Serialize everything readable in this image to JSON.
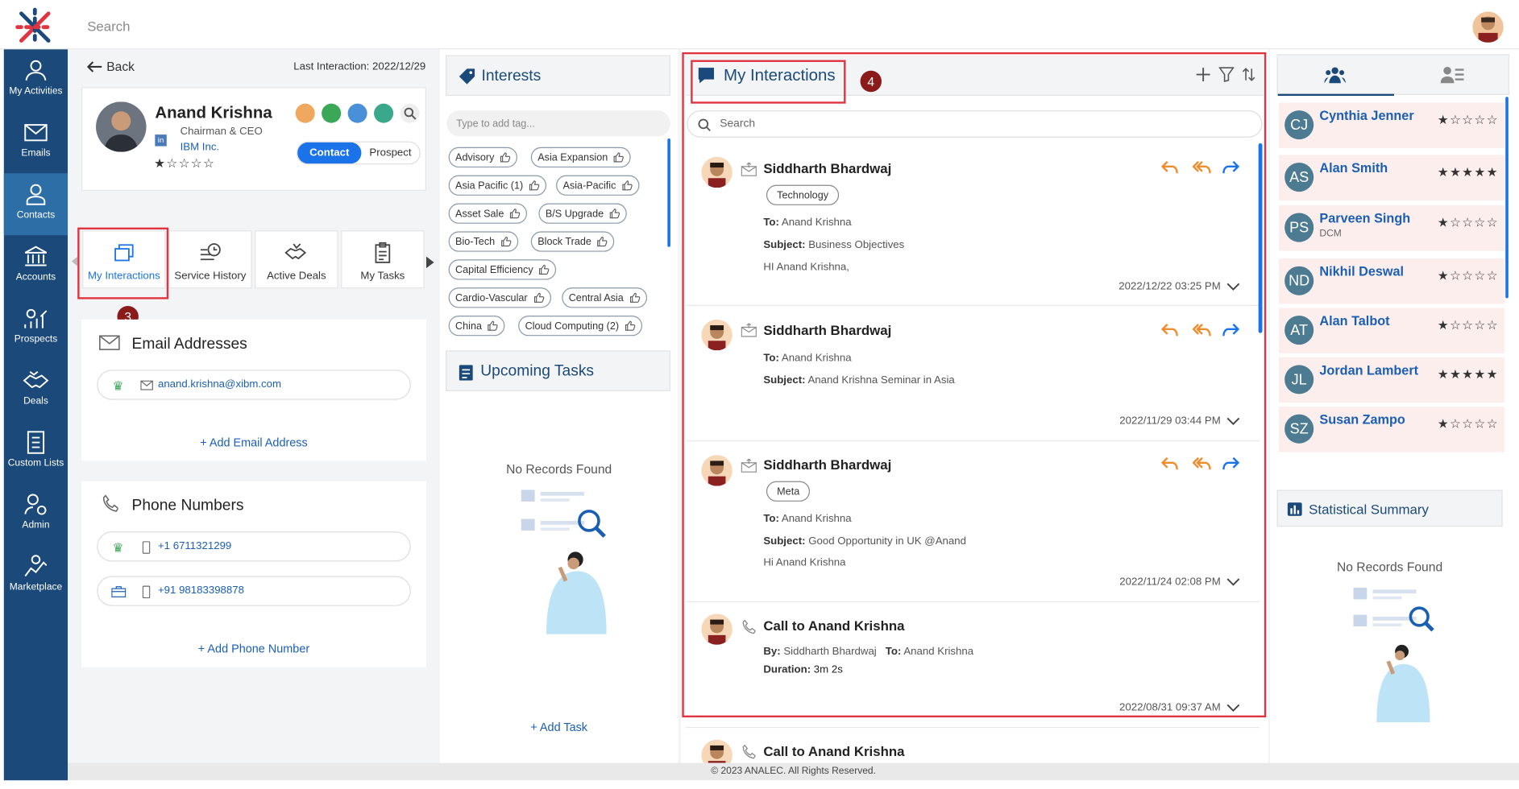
{
  "topbar": {
    "search_placeholder": "Search"
  },
  "sidebar": {
    "items": [
      {
        "label": "My Activities",
        "icon": "user-icon"
      },
      {
        "label": "Emails",
        "icon": "mail-icon"
      },
      {
        "label": "Contacts",
        "icon": "contact-icon"
      },
      {
        "label": "Accounts",
        "icon": "bank-icon"
      },
      {
        "label": "Prospects",
        "icon": "prospects-icon"
      },
      {
        "label": "Deals",
        "icon": "handshake-icon"
      },
      {
        "label": "Custom Lists",
        "icon": "list-icon"
      },
      {
        "label": "Admin",
        "icon": "admin-icon"
      },
      {
        "label": "Marketplace",
        "icon": "marketplace-icon"
      }
    ]
  },
  "contact": {
    "back": "Back",
    "last_interaction": "Last Interaction: 2022/12/29",
    "name": "Anand Krishna",
    "title": "Chairman & CEO",
    "company": "IBM Inc.",
    "toggle": [
      "Contact",
      "Prospect"
    ]
  },
  "tabs": [
    "My Interactions",
    "Service History",
    "Active Deals",
    "My Tasks"
  ],
  "badges": {
    "b3": "3",
    "b4": "4"
  },
  "emails": {
    "heading": "Email Addresses",
    "items": [
      "anand.krishna@xibm.com"
    ],
    "add": "+ Add Email Address"
  },
  "phones": {
    "heading": "Phone Numbers",
    "items": [
      "+1 6711321299",
      "+91 98183398878"
    ],
    "add": "+ Add Phone Number"
  },
  "interests": {
    "heading": "Interests",
    "placeholder": "Type to add tag...",
    "tags": [
      "Advisory",
      "Asia Expansion",
      "Asia Pacific (1)",
      "Asia-Pacific",
      "Asset Sale",
      "B/S Upgrade",
      "Bio-Tech",
      "Block Trade",
      "Capital Efficiency",
      "Cardio-Vascular",
      "Central Asia",
      "China",
      "Cloud Computing (2)"
    ]
  },
  "tasks": {
    "heading": "Upcoming Tasks",
    "empty": "No Records Found",
    "add": "+ Add Task"
  },
  "interactions": {
    "heading": "My Interactions",
    "search_placeholder": "Search",
    "items": [
      {
        "name": "Siddharth Bhardwaj",
        "tag": "Technology",
        "to": "Anand Krishna",
        "subject": "Business Objectives",
        "body": "HI Anand Krishna,",
        "date": "2022/12/22 03:25 PM"
      },
      {
        "name": "Siddharth Bhardwaj",
        "to": "Anand Krishna",
        "subject": "Anand Krishna Seminar in Asia",
        "date": "2022/11/29 03:44 PM"
      },
      {
        "name": "Siddharth Bhardwaj",
        "tag": "Meta",
        "to": "Anand Krishna",
        "subject": "Good Opportunity in UK @Anand",
        "body": "Hi Anand Krishna",
        "date": "2022/11/24 02:08 PM"
      },
      {
        "name": "Call to Anand Krishna",
        "by": "Siddharth Bhardwaj",
        "to": "Anand Krishna",
        "duration": "3m 2s",
        "date": "2022/08/31 09:37 AM"
      },
      {
        "name": "Call to Anand Krishna"
      }
    ],
    "labels": {
      "to": "To:",
      "subject": "Subject:",
      "by": "By:",
      "duration": "Duration:"
    }
  },
  "contacts_list": [
    {
      "initials": "CJ",
      "name": "Cynthia Jenner",
      "sub": "",
      "stars": "★☆☆☆☆"
    },
    {
      "initials": "AS",
      "name": "Alan Smith",
      "sub": "",
      "stars": "★★★★★"
    },
    {
      "initials": "PS",
      "name": "Parveen Singh",
      "sub": "DCM",
      "stars": "★☆☆☆☆"
    },
    {
      "initials": "ND",
      "name": "Nikhil Deswal",
      "sub": "",
      "stars": "★☆☆☆☆"
    },
    {
      "initials": "AT",
      "name": "Alan Talbot",
      "sub": "",
      "stars": "★☆☆☆☆"
    },
    {
      "initials": "JL",
      "name": "Jordan Lambert",
      "sub": "",
      "stars": "★★★★★"
    },
    {
      "initials": "SZ",
      "name": "Susan Zampo",
      "sub": "",
      "stars": "★☆☆☆☆"
    }
  ],
  "stats": {
    "heading": "Statistical Summary",
    "empty": "No Records Found"
  },
  "rating": "★☆☆☆☆",
  "footer": "© 2023 ANALEC. All Rights Reserved.",
  "colors": {
    "sidebar": "#1b4a7a",
    "accent": "#1a73e8",
    "highlight": "#e03540",
    "badge": "#8b1a1a"
  }
}
